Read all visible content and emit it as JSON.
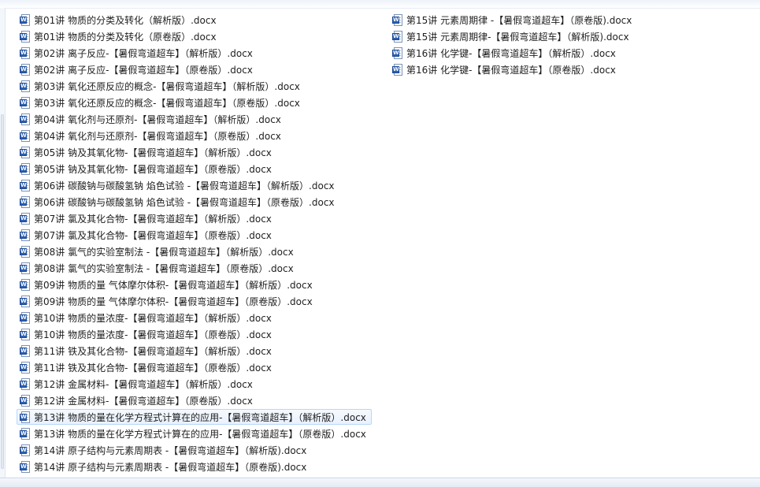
{
  "files": [
    {
      "name": "第01讲 物质的分类及转化（解析版）.docx",
      "icon": "word-doc-icon"
    },
    {
      "name": "第01讲 物质的分类及转化（原卷版）.docx",
      "icon": "word-doc-icon"
    },
    {
      "name": "第02讲 离子反应-【暑假弯道超车】（解析版）.docx",
      "icon": "word-doc-icon"
    },
    {
      "name": "第02讲 离子反应-【暑假弯道超车】（原卷版）.docx",
      "icon": "word-doc-icon"
    },
    {
      "name": "第03讲 氧化还原反应的概念-【暑假弯道超车】（解析版）.docx",
      "icon": "word-doc-icon"
    },
    {
      "name": "第03讲 氧化还原反应的概念-【暑假弯道超车】（原卷版）.docx",
      "icon": "word-doc-icon"
    },
    {
      "name": "第04讲  氧化剂与还原剂-【暑假弯道超车】（解析版）.docx",
      "icon": "word-doc-icon"
    },
    {
      "name": "第04讲  氧化剂与还原剂-【暑假弯道超车】（原卷版）.docx",
      "icon": "word-doc-icon"
    },
    {
      "name": "第05讲 钠及其氧化物-【暑假弯道超车】（解析版）.docx",
      "icon": "word-doc-icon"
    },
    {
      "name": "第05讲 钠及其氧化物-【暑假弯道超车】（原卷版）.docx",
      "icon": "word-doc-icon"
    },
    {
      "name": "第06讲 碳酸钠与碳酸氢钠  焰色试验 -【暑假弯道超车】（解析版）.docx",
      "icon": "word-doc-icon"
    },
    {
      "name": "第06讲 碳酸钠与碳酸氢钠  焰色试验 -【暑假弯道超车】（原卷版）.docx",
      "icon": "word-doc-icon"
    },
    {
      "name": "第07讲 氯及其化合物-【暑假弯道超车】（解析版）.docx",
      "icon": "word-doc-icon"
    },
    {
      "name": "第07讲 氯及其化合物-【暑假弯道超车】（原卷版）.docx",
      "icon": "word-doc-icon"
    },
    {
      "name": "第08讲 氯气的实验室制法 -【暑假弯道超车】（解析版）.docx",
      "icon": "word-doc-icon"
    },
    {
      "name": "第08讲 氯气的实验室制法 -【暑假弯道超车】（原卷版）.docx",
      "icon": "word-doc-icon"
    },
    {
      "name": "第09讲 物质的量  气体摩尔体积-【暑假弯道超车】（解析版）.docx",
      "icon": "word-doc-icon"
    },
    {
      "name": "第09讲 物质的量  气体摩尔体积-【暑假弯道超车】（原卷版）.docx",
      "icon": "word-doc-icon"
    },
    {
      "name": "第10讲 物质的量浓度-【暑假弯道超车】（解析版）.docx",
      "icon": "word-doc-icon"
    },
    {
      "name": "第10讲 物质的量浓度-【暑假弯道超车】（原卷版）.docx",
      "icon": "word-doc-icon"
    },
    {
      "name": "第11讲 铁及其化合物-【暑假弯道超车】（解析版）.docx",
      "icon": "word-doc-icon"
    },
    {
      "name": "第11讲 铁及其化合物-【暑假弯道超车】（原卷版）.docx",
      "icon": "word-doc-icon"
    },
    {
      "name": "第12讲 金属材料-【暑假弯道超车】（解析版）.docx",
      "icon": "word-doc-icon"
    },
    {
      "name": "第12讲 金属材料-【暑假弯道超车】（原卷版）.docx",
      "icon": "word-doc-icon"
    },
    {
      "name": "第13讲  物质的量在化学方程式计算在的应用-【暑假弯道超车】（解析版）.docx",
      "icon": "word-doc-icon"
    },
    {
      "name": "第13讲  物质的量在化学方程式计算在的应用-【暑假弯道超车】（原卷版）.docx",
      "icon": "word-doc-icon"
    },
    {
      "name": "第14讲  原子结构与元素周期表 -【暑假弯道超车】（解析版).docx",
      "icon": "word-doc-icon"
    },
    {
      "name": "第14讲  原子结构与元素周期表 -【暑假弯道超车】（原卷版).docx",
      "icon": "word-doc-icon"
    },
    {
      "name": "第15讲 元素周期律 -【暑假弯道超车】（原卷版).docx",
      "icon": "word-doc-icon"
    },
    {
      "name": "第15讲 元素周期律-【暑假弯道超车】（解析版).docx",
      "icon": "word-doc-icon"
    },
    {
      "name": "第16讲 化学键-【暑假弯道超车】（解析版）.docx",
      "icon": "word-doc-icon"
    },
    {
      "name": "第16讲 化学键-【暑假弯道超车】（原卷版）.docx",
      "icon": "word-doc-icon"
    }
  ],
  "icon_label": "W",
  "colors": {
    "hover_bg": "#e9f2fd",
    "hover_border": "#b8d6fb",
    "icon_blue": "#2b5fb5"
  }
}
